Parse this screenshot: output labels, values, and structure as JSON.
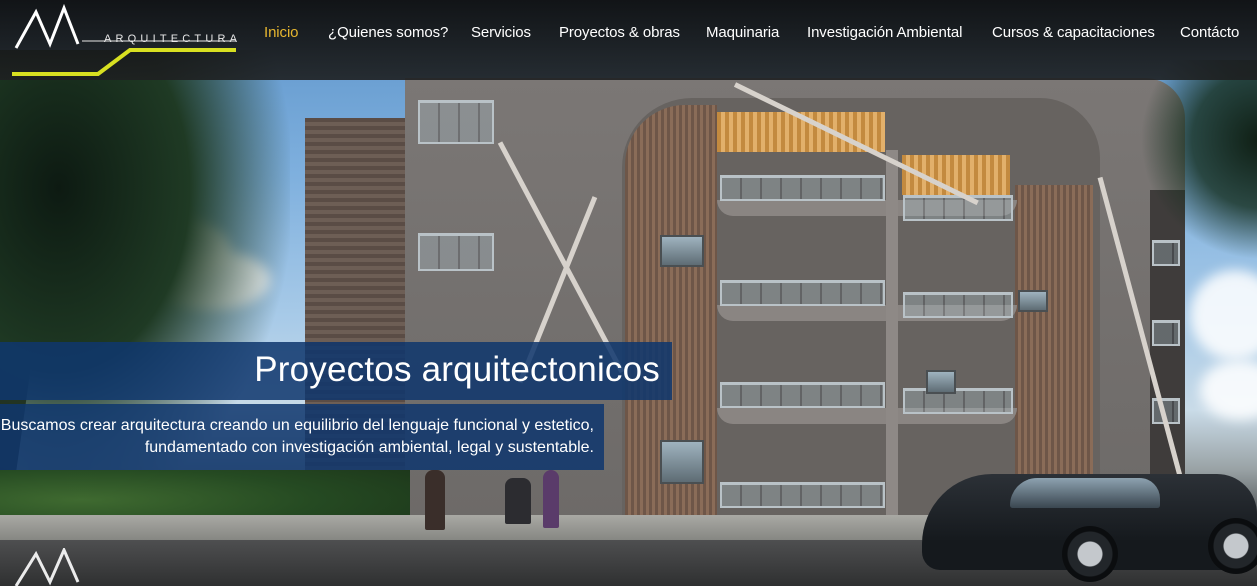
{
  "brand": {
    "logo_text": "ARQUITECTURA",
    "accent_color": "#d8e021"
  },
  "nav": {
    "items": [
      {
        "label": "Inicio",
        "active": true
      },
      {
        "label": "¿Quienes somos?",
        "active": false
      },
      {
        "label": "Servicios",
        "active": false
      },
      {
        "label": "Proyectos & obras",
        "active": false
      },
      {
        "label": "Maquinaria",
        "active": false
      },
      {
        "label": "Investigación Ambiental",
        "active": false
      },
      {
        "label": "Cursos & capacitaciones",
        "active": false
      },
      {
        "label": "Contácto",
        "active": false
      }
    ],
    "active_color": "#e6b62f"
  },
  "hero": {
    "headline": "Proyectos arquitectonicos",
    "description": "Buscamos crear arquitectura creando un equilibrio del lenguaje funcional y estetico, fundamentado con investigación ambiental, legal y sustentable.",
    "caption_color": "#0f376e"
  }
}
